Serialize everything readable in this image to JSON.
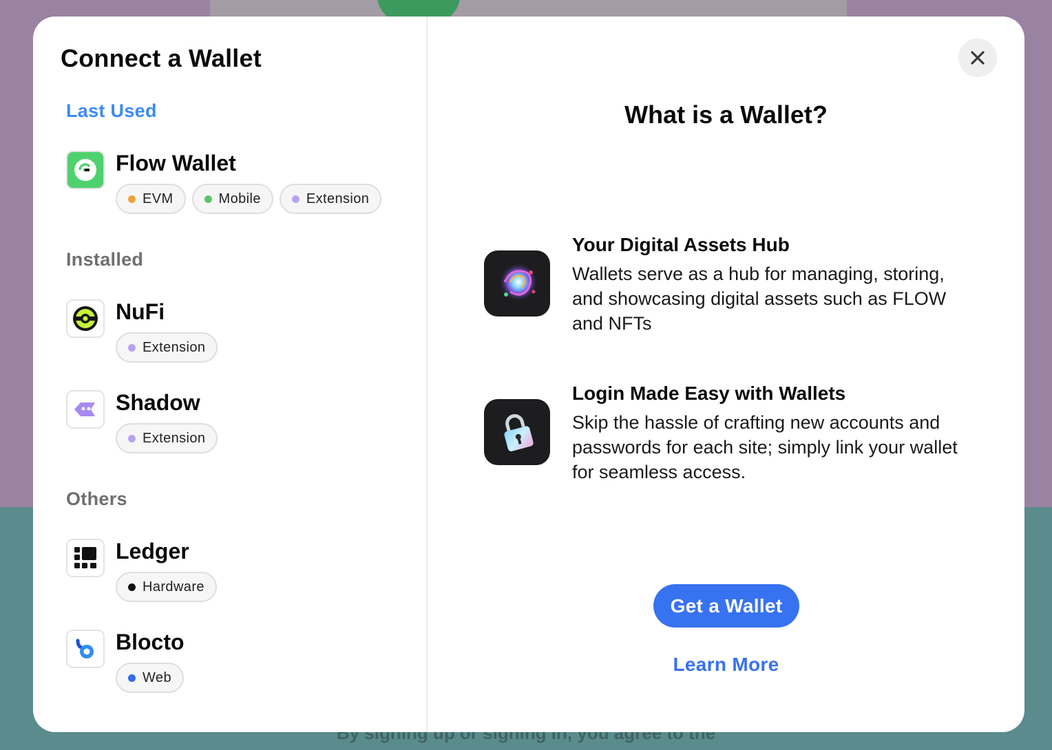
{
  "background": {
    "footer_text": "By signing up or signing in, you agree to the"
  },
  "modal": {
    "title": "Connect a Wallet",
    "sections": {
      "last_used": "Last Used",
      "installed": "Installed",
      "others": "Others"
    },
    "wallets": [
      {
        "name": "Flow Wallet",
        "icon": "flow-wallet-icon",
        "tags": [
          {
            "label": "EVM",
            "color": "#f0a23a"
          },
          {
            "label": "Mobile",
            "color": "#5cc46a"
          },
          {
            "label": "Extension",
            "color": "#b7a2f2"
          }
        ]
      },
      {
        "name": "NuFi",
        "icon": "nufi-icon",
        "tags": [
          {
            "label": "Extension",
            "color": "#b7a2f2"
          }
        ]
      },
      {
        "name": "Shadow",
        "icon": "shadow-icon",
        "tags": [
          {
            "label": "Extension",
            "color": "#b7a2f2"
          }
        ]
      },
      {
        "name": "Ledger",
        "icon": "ledger-icon",
        "tags": [
          {
            "label": "Hardware",
            "color": "#111111"
          }
        ]
      },
      {
        "name": "Blocto",
        "icon": "blocto-icon",
        "tags": [
          {
            "label": "Web",
            "color": "#2f6cf0"
          }
        ]
      }
    ],
    "info": {
      "title": "What is a Wallet?",
      "features": [
        {
          "title": "Your Digital Assets Hub",
          "description": "Wallets serve as a hub for managing, storing, and showcasing digital assets such as FLOW and NFTs",
          "icon": "galaxy-icon"
        },
        {
          "title": "Login Made Easy with Wallets",
          "description": "Skip the hassle of crafting new accounts and passwords for each site; simply link your wallet for seamless access.",
          "icon": "padlock-icon"
        }
      ],
      "get_wallet_label": "Get a Wallet",
      "learn_more_label": "Learn More"
    },
    "colors": {
      "accent": "#3772f0",
      "section_blue": "#3b8bf3"
    }
  }
}
